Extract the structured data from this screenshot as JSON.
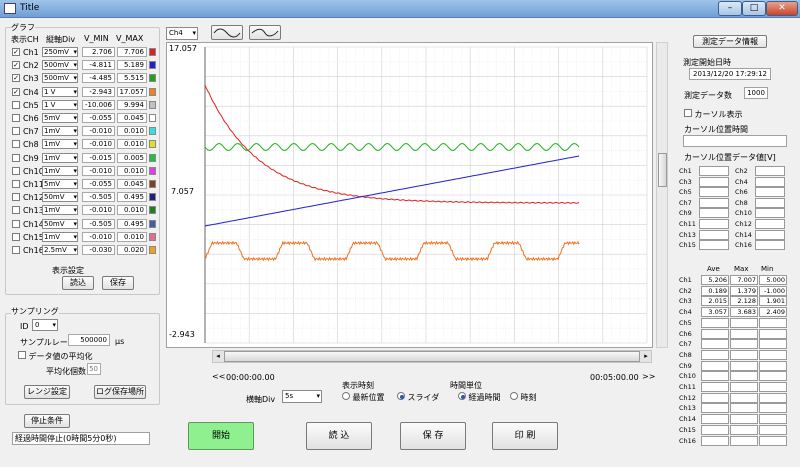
{
  "window": {
    "title": "Title",
    "min": "–",
    "max": "□",
    "close": "✕"
  },
  "graph_group": {
    "label": "グラフ",
    "headers": {
      "show": "表示CH",
      "div": "縦軸Div",
      "vmin": "V_MIN",
      "vmax": "V_MAX"
    },
    "channels": [
      {
        "name": "Ch1",
        "checked": true,
        "div": "250mV",
        "vmin": "2.706",
        "vmax": "7.706",
        "color": "#e02020"
      },
      {
        "name": "Ch2",
        "checked": true,
        "div": "500mV",
        "vmin": "-4.811",
        "vmax": "5.189",
        "color": "#2020d0"
      },
      {
        "name": "Ch3",
        "checked": true,
        "div": "500mV",
        "vmin": "-4.485",
        "vmax": "5.515",
        "color": "#20a020"
      },
      {
        "name": "Ch4",
        "checked": true,
        "div": "1 V",
        "vmin": "-2.943",
        "vmax": "17.057",
        "color": "#f08020"
      },
      {
        "name": "Ch5",
        "checked": false,
        "div": "1 V",
        "vmin": "-10.006",
        "vmax": "9.994",
        "color": "#c0c0c0"
      },
      {
        "name": "Ch6",
        "checked": false,
        "div": "5mV",
        "vmin": "-0.055",
        "vmax": "0.045",
        "color": "#ffffff"
      },
      {
        "name": "Ch7",
        "checked": false,
        "div": "1mV",
        "vmin": "-0.010",
        "vmax": "0.010",
        "color": "#30e0e0"
      },
      {
        "name": "Ch8",
        "checked": false,
        "div": "1mV",
        "vmin": "-0.010",
        "vmax": "0.010",
        "color": "#e0e020"
      },
      {
        "name": "Ch9",
        "checked": false,
        "div": "1mV",
        "vmin": "-0.015",
        "vmax": "0.005",
        "color": "#20c040"
      },
      {
        "name": "Ch10",
        "checked": false,
        "div": "1mV",
        "vmin": "-0.010",
        "vmax": "0.010",
        "color": "#e040e0"
      },
      {
        "name": "Ch11",
        "checked": false,
        "div": "5mV",
        "vmin": "-0.055",
        "vmax": "0.045",
        "color": "#804020"
      },
      {
        "name": "Ch12",
        "checked": false,
        "div": "50mV",
        "vmin": "-0.505",
        "vmax": "0.495",
        "color": "#202080"
      },
      {
        "name": "Ch13",
        "checked": false,
        "div": "1mV",
        "vmin": "-0.010",
        "vmax": "0.010",
        "color": "#208020"
      },
      {
        "name": "Ch14",
        "checked": false,
        "div": "50mV",
        "vmin": "-0.505",
        "vmax": "0.495",
        "color": "#4060a0"
      },
      {
        "name": "Ch15",
        "checked": false,
        "div": "1mV",
        "vmin": "-0.010",
        "vmax": "0.010",
        "color": "#e07090"
      },
      {
        "name": "Ch16",
        "checked": false,
        "div": "2.5mV",
        "vmin": "-0.030",
        "vmax": "0.020",
        "color": "#f0a020"
      }
    ],
    "display_settings": "表示設定",
    "load_btn": "読込",
    "save_btn": "保存"
  },
  "sampling": {
    "label": "サンプリング",
    "id_label": "ID",
    "id_value": "0",
    "rate_label": "サンプルレート",
    "rate_value": "500000",
    "rate_unit": "μs",
    "avg_label": "データ値の平均化",
    "avg_count_label": "平均化個数",
    "avg_count_value": "50",
    "range_btn": "レンジ設定",
    "log_btn": "ログ保存場所"
  },
  "stop": {
    "btn": "停止条件",
    "text": "経過時間停止(0時間5分0秒)"
  },
  "plot": {
    "channel_select": "Ch4",
    "ytop": "17.057",
    "ymid": "7.057",
    "ybottom": "-2.943",
    "time_start": "00:00:00.00",
    "time_end": "00:05:00.00",
    "nav_left": "<<",
    "nav_right": ">>"
  },
  "controls": {
    "hdiv_label": "横軸Div",
    "hdiv_value": "5s",
    "display_time_label": "表示時刻",
    "latest": "最新位置",
    "slider": "スライダ",
    "time_unit_label": "時間単位",
    "elapsed": "経過時間",
    "clock": "時刻"
  },
  "bottom_buttons": {
    "start": "開始",
    "load": "読 込",
    "save": "保 存",
    "print": "印 刷"
  },
  "right": {
    "info_btn": "測定データ情報",
    "start_time_label": "測定開始日時",
    "start_time_value": "2013/12/20 17:29:12",
    "count_label": "測定データ数",
    "count_value": "1000",
    "cursor_cb": "カーソル表示",
    "cursor_time_label": "カーソル位置時間",
    "cursor_data_label": "カーソル位置データ値[V]",
    "cursor_ch": [
      "Ch1",
      "Ch2",
      "Ch3",
      "Ch4",
      "Ch5",
      "Ch6",
      "Ch7",
      "Ch8",
      "Ch9",
      "Ch10",
      "Ch11",
      "Ch12",
      "Ch13",
      "Ch14",
      "Ch15",
      "Ch16"
    ],
    "stats_headers": [
      "Ave",
      "Max",
      "Min"
    ],
    "stats": [
      {
        "ch": "Ch1",
        "ave": "5.206",
        "max": "7.007",
        "min": "5.000"
      },
      {
        "ch": "Ch2",
        "ave": "0.189",
        "max": "1.379",
        "min": "-1.000"
      },
      {
        "ch": "Ch3",
        "ave": "2.015",
        "max": "2.128",
        "min": "1.901"
      },
      {
        "ch": "Ch4",
        "ave": "3.057",
        "max": "3.683",
        "min": "2.409"
      },
      {
        "ch": "Ch5",
        "ave": "",
        "max": "",
        "min": ""
      },
      {
        "ch": "Ch6",
        "ave": "",
        "max": "",
        "min": ""
      },
      {
        "ch": "Ch7",
        "ave": "",
        "max": "",
        "min": ""
      },
      {
        "ch": "Ch8",
        "ave": "",
        "max": "",
        "min": ""
      },
      {
        "ch": "Ch9",
        "ave": "",
        "max": "",
        "min": ""
      },
      {
        "ch": "Ch10",
        "ave": "",
        "max": "",
        "min": ""
      },
      {
        "ch": "Ch11",
        "ave": "",
        "max": "",
        "min": ""
      },
      {
        "ch": "Ch12",
        "ave": "",
        "max": "",
        "min": ""
      },
      {
        "ch": "Ch13",
        "ave": "",
        "max": "",
        "min": ""
      },
      {
        "ch": "Ch14",
        "ave": "",
        "max": "",
        "min": ""
      },
      {
        "ch": "Ch15",
        "ave": "",
        "max": "",
        "min": ""
      },
      {
        "ch": "Ch16",
        "ave": "",
        "max": "",
        "min": ""
      }
    ]
  },
  "chart_data": {
    "type": "line",
    "xlim": [
      "00:00:00.00",
      "00:05:00.00"
    ],
    "y_ticks": [
      "17.057",
      "7.057",
      "-2.943"
    ],
    "grid": true,
    "series": [
      {
        "name": "Ch1",
        "color": "#e02020",
        "shape": "exponential decay from top-left to steady level ~ 1/3 down"
      },
      {
        "name": "Ch2",
        "color": "#2020d0",
        "shape": "linear ramp rising left to right"
      },
      {
        "name": "Ch3",
        "color": "#20b020",
        "shape": "small-amplitude sine"
      },
      {
        "name": "Ch4",
        "color": "#f07020",
        "shape": "noisy trapezoid pulse train"
      }
    ]
  }
}
